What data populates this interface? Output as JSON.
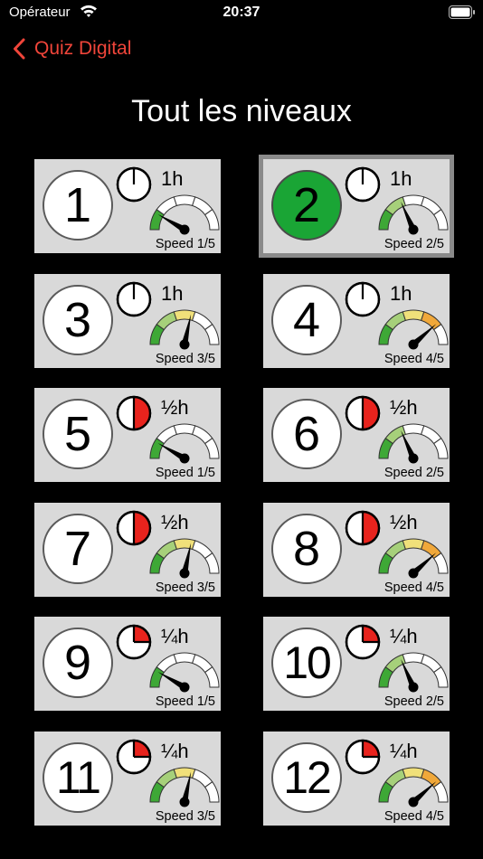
{
  "status_bar": {
    "carrier": "Opérateur",
    "time": "20:37"
  },
  "nav": {
    "back_label": "Quiz Digital"
  },
  "page": {
    "title": "Tout les niveaux"
  },
  "colors": {
    "accent": "#f0453a",
    "active_level": "#1aa535",
    "timer_red": "#e8231d",
    "card_bg": "#d9d9d9"
  },
  "levels": [
    {
      "number": "1",
      "duration": "1h",
      "timer_fraction": 0,
      "speed": 1,
      "speed_label": "Speed 1/5",
      "selected": false
    },
    {
      "number": "2",
      "duration": "1h",
      "timer_fraction": 0,
      "speed": 2,
      "speed_label": "Speed 2/5",
      "selected": true
    },
    {
      "number": "3",
      "duration": "1h",
      "timer_fraction": 0,
      "speed": 3,
      "speed_label": "Speed 3/5",
      "selected": false
    },
    {
      "number": "4",
      "duration": "1h",
      "timer_fraction": 0,
      "speed": 4,
      "speed_label": "Speed 4/5",
      "selected": false
    },
    {
      "number": "5",
      "duration": "½h",
      "timer_fraction": 0.5,
      "speed": 1,
      "speed_label": "Speed 1/5",
      "selected": false
    },
    {
      "number": "6",
      "duration": "½h",
      "timer_fraction": 0.5,
      "speed": 2,
      "speed_label": "Speed 2/5",
      "selected": false
    },
    {
      "number": "7",
      "duration": "½h",
      "timer_fraction": 0.5,
      "speed": 3,
      "speed_label": "Speed 3/5",
      "selected": false
    },
    {
      "number": "8",
      "duration": "½h",
      "timer_fraction": 0.5,
      "speed": 4,
      "speed_label": "Speed 4/5",
      "selected": false
    },
    {
      "number": "9",
      "duration": "¼h",
      "timer_fraction": 0.25,
      "speed": 1,
      "speed_label": "Speed 1/5",
      "selected": false
    },
    {
      "number": "10",
      "duration": "¼h",
      "timer_fraction": 0.25,
      "speed": 2,
      "speed_label": "Speed 2/5",
      "selected": false
    },
    {
      "number": "11",
      "duration": "¼h",
      "timer_fraction": 0.25,
      "speed": 3,
      "speed_label": "Speed 3/5",
      "selected": false
    },
    {
      "number": "12",
      "duration": "¼h",
      "timer_fraction": 0.25,
      "speed": 4,
      "speed_label": "Speed 4/5",
      "selected": false
    }
  ]
}
